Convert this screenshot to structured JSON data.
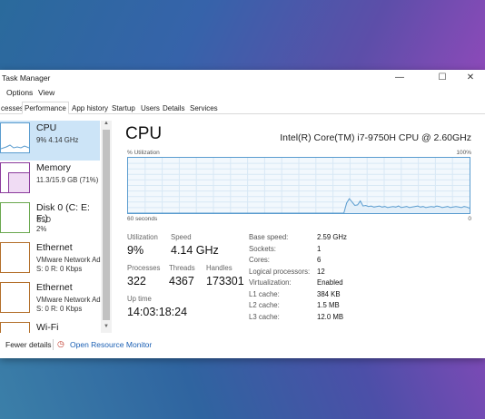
{
  "window": {
    "title": "Task Manager"
  },
  "menu": [
    "Options",
    "View"
  ],
  "tabs": [
    "cesses",
    "Performance",
    "App history",
    "Startup",
    "Users",
    "Details",
    "Services"
  ],
  "resources": [
    {
      "name": "CPU",
      "sub1": "9%  4.14 GHz"
    },
    {
      "name": "Memory",
      "sub1": "11.3/15.9 GB (71%)"
    },
    {
      "name": "Disk 0 (C: E: F:)",
      "sub1": "SSD",
      "sub2": "2%"
    },
    {
      "name": "Ethernet",
      "sub1": "VMware Network Ad",
      "sub2": "S: 0  R: 0 Kbps"
    },
    {
      "name": "Ethernet",
      "sub1": "VMware Network Ad",
      "sub2": "S: 0  R: 0 Kbps"
    },
    {
      "name": "Wi-Fi"
    }
  ],
  "cpu": {
    "heading": "CPU",
    "model": "Intel(R) Core(TM) i7-9750H CPU @ 2.60GHz",
    "util_label": "% Utilization",
    "util_max": "100%",
    "x_left": "60 seconds",
    "x_right": "0",
    "utilization_history": [
      0,
      0,
      0,
      0,
      0,
      0,
      0,
      0,
      0,
      0,
      0,
      0,
      0,
      0,
      0,
      0,
      0,
      0,
      0,
      0,
      0,
      0,
      0,
      0,
      0,
      0,
      0,
      0,
      0,
      0,
      0,
      0,
      0,
      0,
      0,
      0,
      0,
      0,
      0,
      0,
      0,
      0,
      0,
      0,
      0,
      0,
      0,
      0,
      0,
      0,
      0,
      0,
      0,
      0,
      0,
      0,
      0,
      0,
      0,
      0,
      0,
      0,
      0,
      0,
      0,
      0,
      0,
      0,
      0,
      0,
      0,
      0,
      0,
      0,
      0,
      0,
      0,
      0,
      0,
      0,
      18,
      26,
      20,
      14,
      15,
      22,
      13,
      14,
      12,
      13,
      11,
      12,
      13,
      11,
      12,
      10,
      11,
      12,
      11,
      13,
      10,
      11,
      12,
      10,
      11,
      12,
      13,
      11,
      12,
      10,
      11,
      12,
      11,
      13,
      12,
      10,
      11,
      12,
      10,
      11,
      12,
      11,
      10,
      12,
      11,
      9
    ]
  },
  "stats": {
    "utilization": {
      "label": "Utilization",
      "value": "9%"
    },
    "speed": {
      "label": "Speed",
      "value": "4.14 GHz"
    },
    "processes": {
      "label": "Processes",
      "value": "322"
    },
    "threads": {
      "label": "Threads",
      "value": "4367"
    },
    "handles": {
      "label": "Handles",
      "value": "173301"
    },
    "uptime": {
      "label": "Up time",
      "value": "14:03:18:24"
    }
  },
  "specs": [
    {
      "label": "Base speed:",
      "value": "2.59 GHz"
    },
    {
      "label": "Sockets:",
      "value": "1"
    },
    {
      "label": "Cores:",
      "value": "6"
    },
    {
      "label": "Logical processors:",
      "value": "12"
    },
    {
      "label": "Virtualization:",
      "value": "Enabled"
    },
    {
      "label": "L1 cache:",
      "value": "384 KB"
    },
    {
      "label": "L2 cache:",
      "value": "1.5 MB"
    },
    {
      "label": "L3 cache:",
      "value": "12.0 MB"
    }
  ],
  "footer": {
    "fewer": "Fewer details",
    "monitor": "Open Resource Monitor"
  },
  "colors": {
    "cpu": "#5a9ccf",
    "memory": "#8b3b9c",
    "disk": "#6aa84f",
    "ethernet": "#b36f2a",
    "selected": "#cce4f7"
  }
}
